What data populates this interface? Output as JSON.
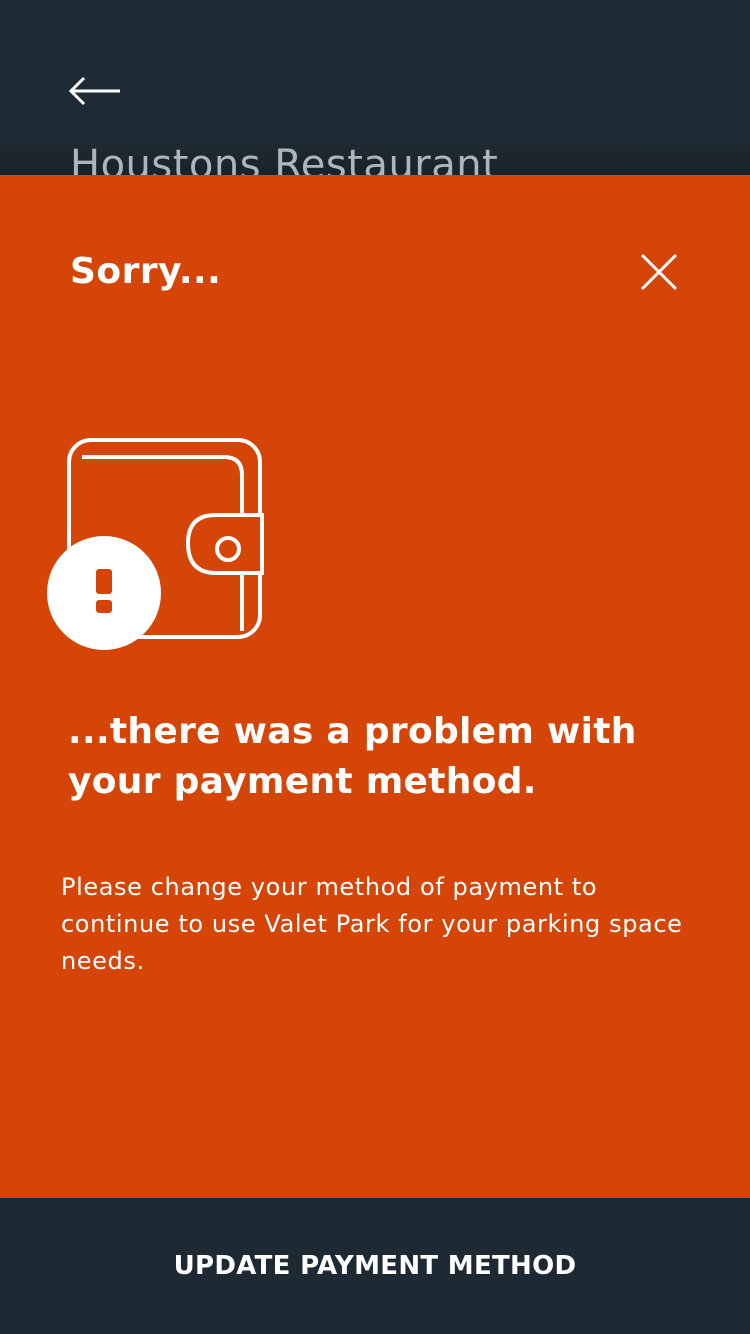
{
  "header": {
    "back_icon": "arrow-left-icon",
    "venue_title": "Houstons Restaurant"
  },
  "modal": {
    "title": "Sorry...",
    "close_icon": "close-icon",
    "illustration_icon": "wallet-warning-icon",
    "headline": "...there was a problem with your payment method.",
    "body": "Please change your method of payment to continue to use Valet Park for your parking space needs."
  },
  "footer": {
    "button_label": "UPDATE PAYMENT METHOD"
  },
  "colors": {
    "accent": "#d64508",
    "dark": "#1e2a33",
    "text": "#ffffff"
  }
}
